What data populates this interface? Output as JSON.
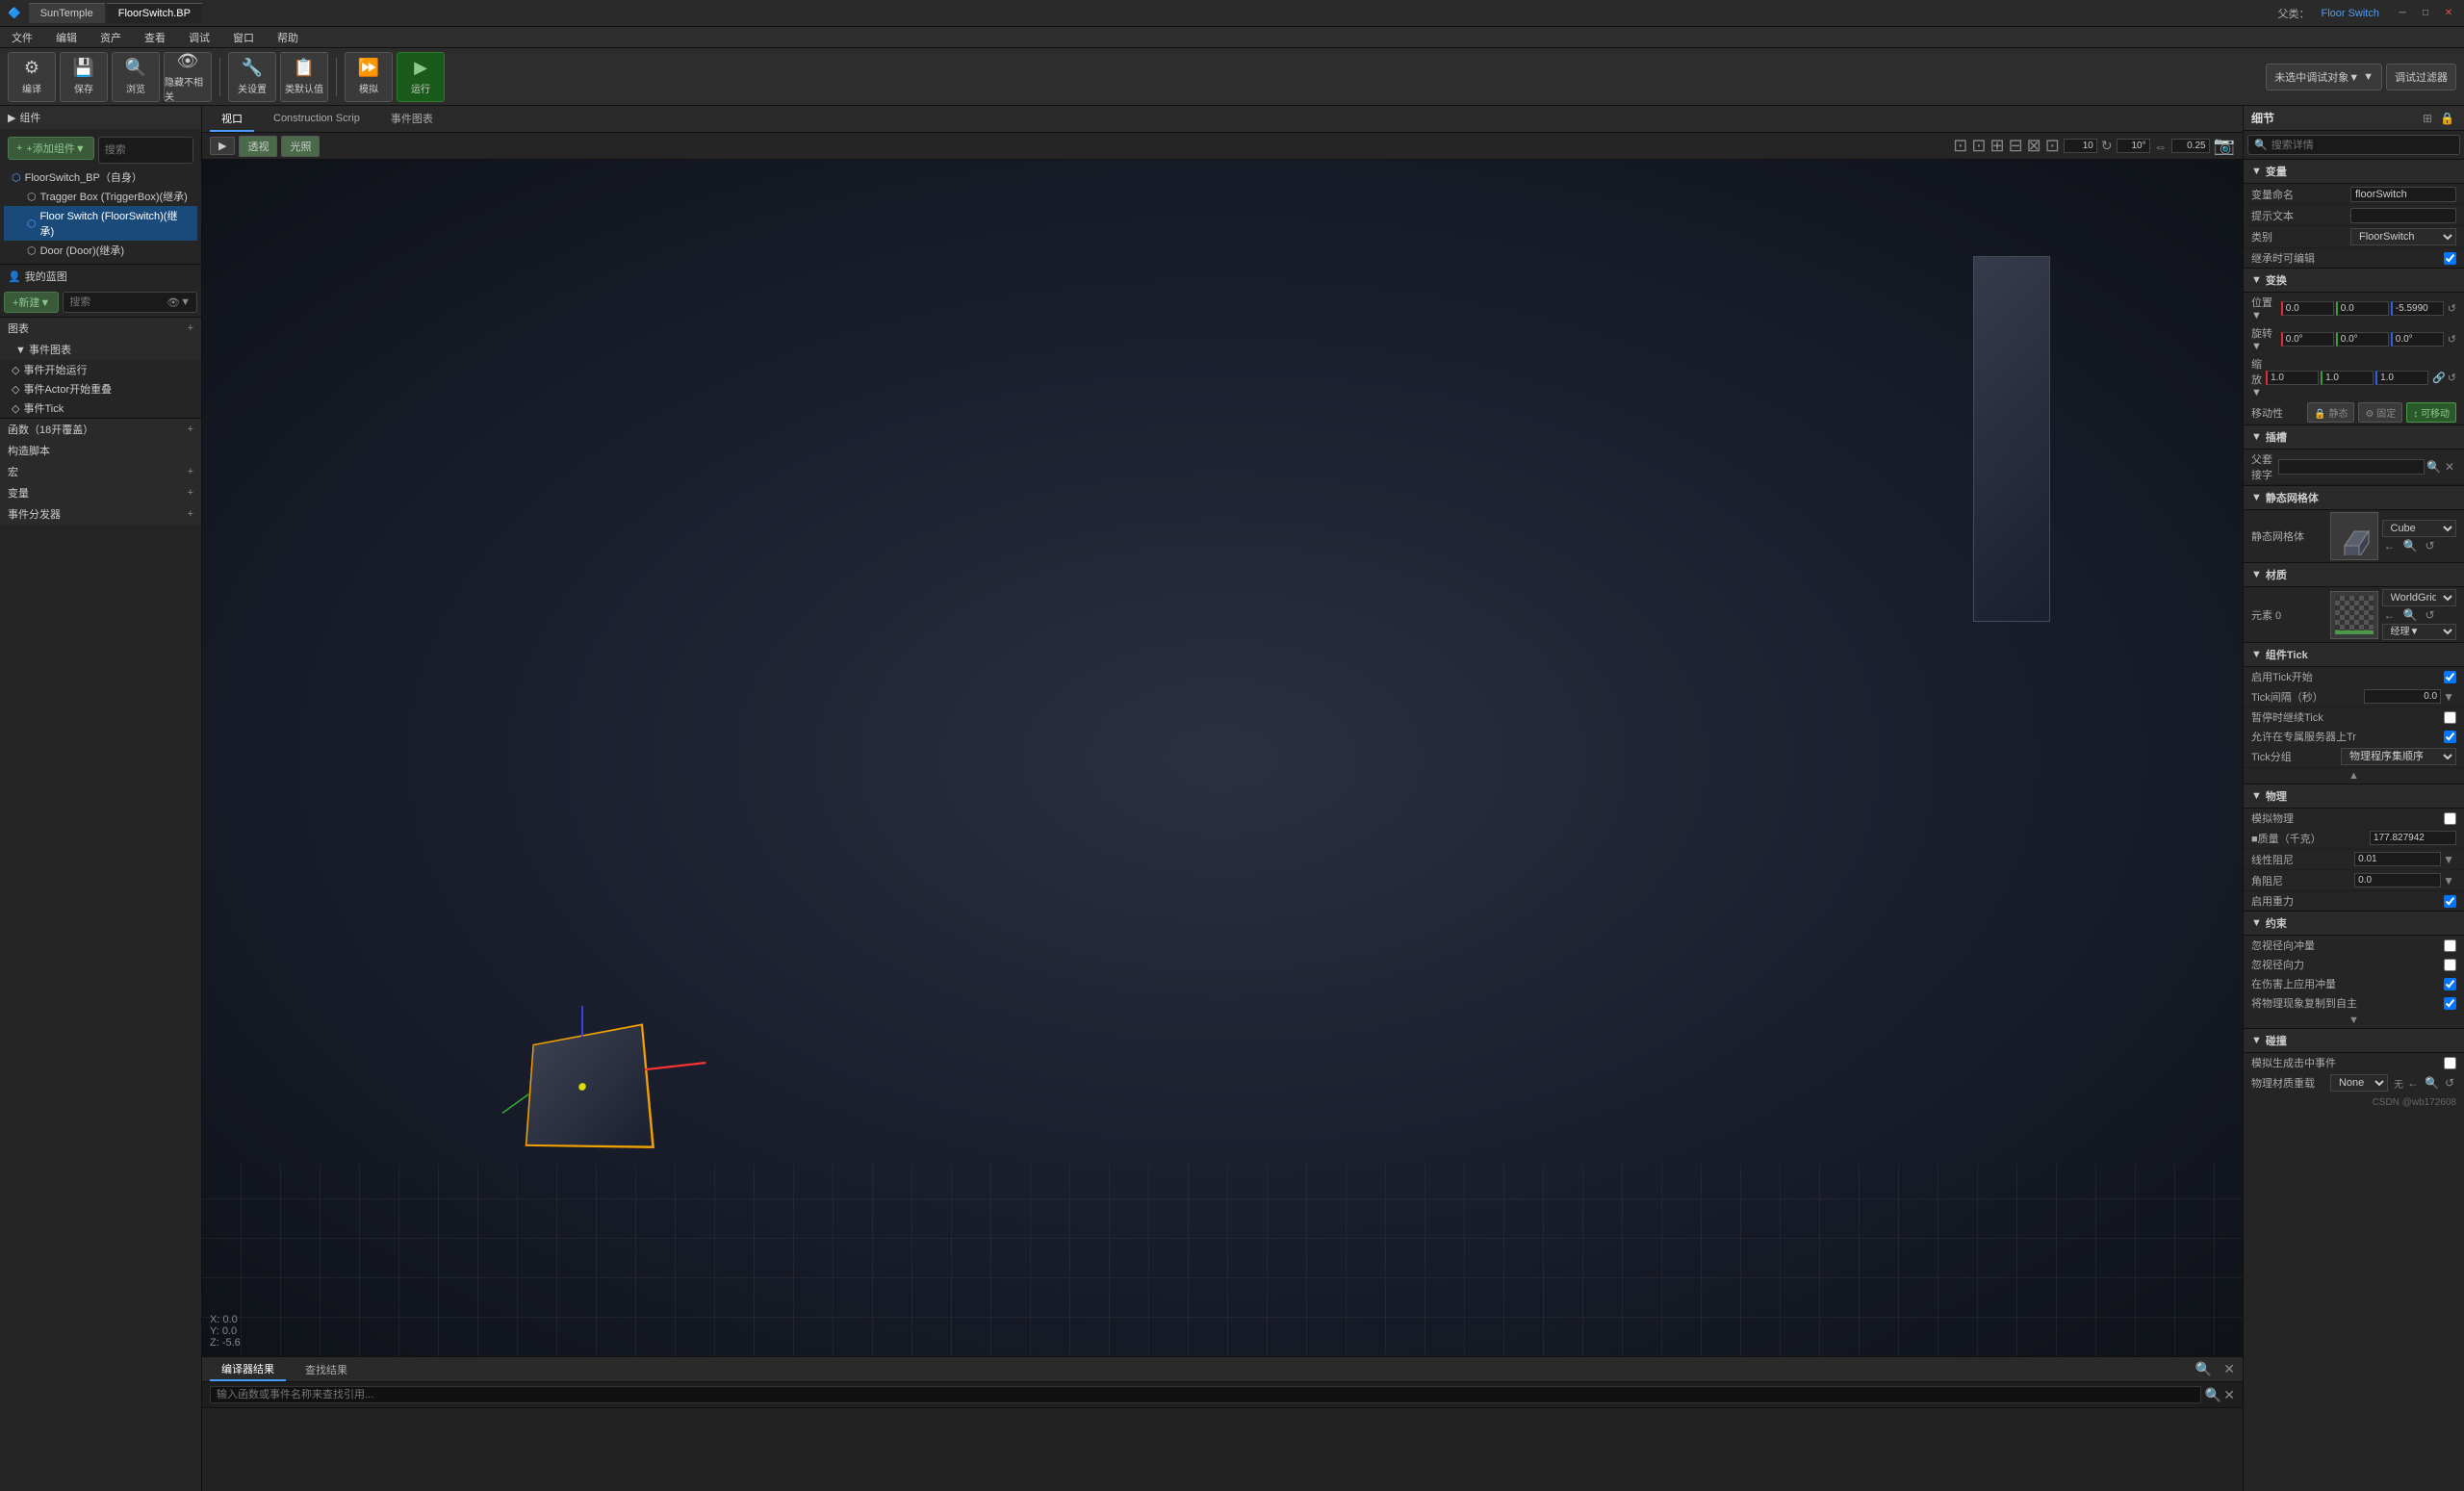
{
  "titlebar": {
    "tabs": [
      {
        "label": "SunTemple",
        "active": false
      },
      {
        "label": "FloorSwitch.BP",
        "active": true
      }
    ],
    "window_controls": [
      "─",
      "□",
      "✕"
    ]
  },
  "menubar": {
    "items": [
      "文件",
      "编辑",
      "资产",
      "查看",
      "调试",
      "窗口",
      "帮助"
    ]
  },
  "toolbar": {
    "compile_label": "编译",
    "save_label": "保存",
    "browse_label": "浏览",
    "hide_label": "隐藏不相关",
    "settings_label": "关设置",
    "defaults_label": "类默认值",
    "simulate_label": "模拟",
    "run_label": "运行",
    "debug_dropdown": "未选中调试对象▼",
    "debug_filter": "调试过滤器"
  },
  "viewport_tabs": {
    "tabs": [
      {
        "label": "视口",
        "active": true
      },
      {
        "label": "Construction Scrip",
        "active": false
      },
      {
        "label": "事件图表",
        "active": false
      }
    ]
  },
  "viewport_toolbar": {
    "perspective": "透视",
    "lit": "光照",
    "toolbar_btns": [
      "10",
      "10°",
      "0.25"
    ]
  },
  "bottom_tabs": {
    "tabs": [
      {
        "label": "编译器结果",
        "active": true
      },
      {
        "label": "查找结果",
        "active": false
      }
    ],
    "search_placeholder": "输入函数或事件名称来查找引用...",
    "output": ""
  },
  "left_panel": {
    "components_title": "组件",
    "add_component_label": "+添加组件▼",
    "search_placeholder": "搜索",
    "tree_items": [
      {
        "label": "FloorSwitch_BP（自身）",
        "level": 0,
        "expanded": true
      },
      {
        "label": "Tragger Box (TriggerBox)(继承)",
        "level": 1,
        "expanded": true
      },
      {
        "label": "Floor Switch (FloorSwitch)(继承)",
        "level": 1,
        "selected": true
      },
      {
        "label": "Door (Door)(继承)",
        "level": 1
      }
    ],
    "my_blueprints_title": "我的蓝图",
    "new_label": "+新建▼",
    "search_placeholder2": "搜索",
    "graphs_title": "图表",
    "event_graph_title": "▼ 事件图表",
    "event_items": [
      {
        "label": "◇ 事件开始运行"
      },
      {
        "label": "◇ 事件Actor开始重叠"
      },
      {
        "label": "◇ 事件Tick"
      }
    ],
    "functions_title": "函数（18开覆盖）",
    "construction_title": "构造脚本",
    "macros_title": "宏",
    "variables_title": "变量",
    "dispatchers_title": "事件分发器"
  },
  "right_panel": {
    "title": "细节",
    "search_placeholder": "搜索详情",
    "view_btn": "⊞",
    "sections": {
      "variables": {
        "title": "变量",
        "name_label": "变量命名",
        "name_value": "floorSwitch",
        "tooltip_label": "提示文本",
        "tooltip_value": "",
        "category_label": "类别",
        "category_value": "FloorSwitch",
        "editable_label": "继承时可编辑",
        "editable_checked": true
      },
      "transform": {
        "title": "变换",
        "position_label": "位置▼",
        "position": {
          "x": "0.0",
          "y": "0.0",
          "z": "-5.5990"
        },
        "rotation_label": "旋转▼",
        "rotation": {
          "x": "0.0°",
          "y": "0.0°",
          "z": "0.0°"
        },
        "scale_label": "缩放▼",
        "scale": {
          "x": "1.0",
          "y": "1.0",
          "z": "1.0"
        },
        "mobility_label": "移动性",
        "mobility_options": [
          "静态",
          "固定",
          "可移动"
        ],
        "mobility_active": "可移动"
      },
      "slots": {
        "title": "插槽",
        "parent_label": "父套接字",
        "parent_value": ""
      },
      "static_mesh": {
        "title": "静态网格体",
        "label": "静态网格体",
        "mesh_name": "Cube"
      },
      "material": {
        "title": "材质",
        "element_label": "元素 0",
        "material_name": "WorldGridMaterial",
        "path_label": "经理▼"
      },
      "tick": {
        "title": "组件Tick",
        "start_label": "启用Tick开始",
        "start_checked": true,
        "interval_label": "Tick间隔（秒）",
        "interval_value": "0.0",
        "managed_label": "暂停时继续Tick",
        "managed_checked": false,
        "allow_label": "允许在专属服务器上Tr",
        "allow_checked": true,
        "group_label": "Tick分组",
        "group_value": "物理程序集顺序"
      },
      "physics": {
        "title": "物理",
        "simulate_label": "模拟物理",
        "simulate_checked": false,
        "mass_label": "■质量（千克）",
        "mass_value": "177.827942",
        "linear_label": "线性阻尼",
        "linear_value": "0.01",
        "angular_label": "角阻尼",
        "angular_value": "0.0",
        "gravity_label": "启用重力",
        "gravity_checked": true
      },
      "constraints": {
        "title": "约束",
        "impulse_label": "忽视径向冲量",
        "impulse_checked": false,
        "force_label": "忽视径向力",
        "force_checked": false,
        "apply_label": "在伤害上应用冲量",
        "apply_checked": true,
        "replicate_label": "将物理现象复制到自主",
        "replicate_checked": true
      },
      "collision": {
        "title": "碰撞",
        "events_label": "模拟生成击中事件",
        "events_checked": false,
        "material_label": "物理材质重载",
        "material_value": "None"
      }
    }
  },
  "scene": {
    "cube_label": "Cube mesh (selected)",
    "wall_label": "Door/Wall mesh"
  }
}
